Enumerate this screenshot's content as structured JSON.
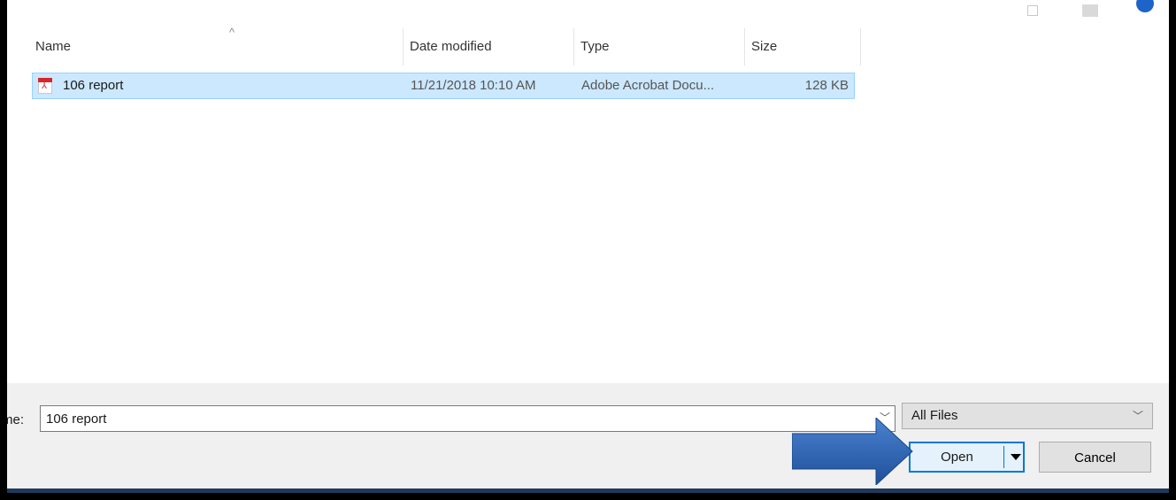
{
  "columns": {
    "name": "Name",
    "date_modified": "Date modified",
    "type": "Type",
    "size": "Size"
  },
  "files": [
    {
      "icon": "pdf-icon",
      "name": "106 report",
      "date_modified": "11/21/2018 10:10 AM",
      "type": "Adobe Acrobat Docu...",
      "size": "128 KB"
    }
  ],
  "bottom_bar": {
    "file_name_label": "me:",
    "file_name_value": "106 report",
    "file_type_selected": "All Files",
    "open_label": "Open",
    "cancel_label": "Cancel"
  },
  "colors": {
    "selection_fill": "#cce8ff",
    "selection_border": "#99d1ff",
    "primary_button_border": "#0078d7",
    "callout_arrow": "#2e64b4"
  }
}
